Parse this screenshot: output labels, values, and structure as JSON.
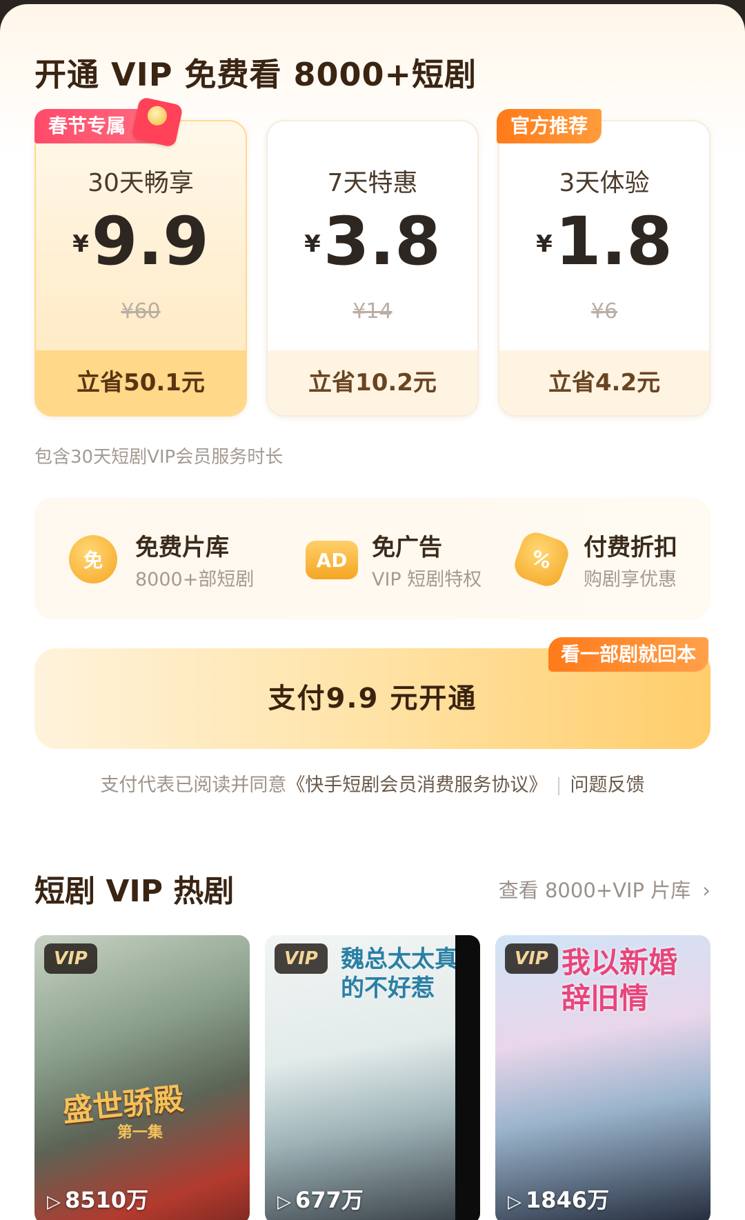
{
  "header": {
    "title": "开通 VIP 免费看 8000+短剧"
  },
  "plans": [
    {
      "badge": "春节专属",
      "name": "30天畅享",
      "currency": "¥",
      "price": "9.9",
      "original": "¥60",
      "save": "立省50.1元",
      "selected": true
    },
    {
      "badge": "",
      "name": "7天特惠",
      "currency": "¥",
      "price": "3.8",
      "original": "¥14",
      "save": "立省10.2元",
      "selected": false
    },
    {
      "badge": "官方推荐",
      "name": "3天体验",
      "currency": "¥",
      "price": "1.8",
      "original": "¥6",
      "save": "立省4.2元",
      "selected": false
    }
  ],
  "plan_note": "包含30天短剧VIP会员服务时长",
  "benefits": [
    {
      "icon": "free-icon",
      "icon_text": "免",
      "title": "免费片库",
      "subtitle": "8000+部短剧"
    },
    {
      "icon": "ad-icon",
      "icon_text": "AD",
      "title": "免广告",
      "subtitle": "VIP 短剧特权"
    },
    {
      "icon": "discount-icon",
      "icon_text": "%",
      "title": "付费折扣",
      "subtitle": "购剧享优惠"
    }
  ],
  "pay": {
    "label": "支付9.9 元开通",
    "tag": "看一部剧就回本"
  },
  "agreement": {
    "prefix": "支付代表已阅读并同意",
    "link": "《快手短剧会员消费服务协议》",
    "separator": "|",
    "feedback": "问题反馈"
  },
  "section": {
    "title": "短剧 VIP 热剧",
    "more": "查看 8000+VIP 片库"
  },
  "dramas": [
    {
      "badge": "VIP",
      "title": "盛世骄殿",
      "subtitle": "第一集",
      "views": "8510万"
    },
    {
      "badge": "VIP",
      "title": "魏总太太真的不好惹",
      "views": "677万"
    },
    {
      "badge": "VIP",
      "title": "我以新婚辞旧情",
      "views": "1846万"
    }
  ],
  "colors": {
    "accent": "#ffcd6b",
    "badge_red": "#ff4a6a",
    "badge_orange": "#ff7a1a",
    "title": "#3a2412"
  }
}
